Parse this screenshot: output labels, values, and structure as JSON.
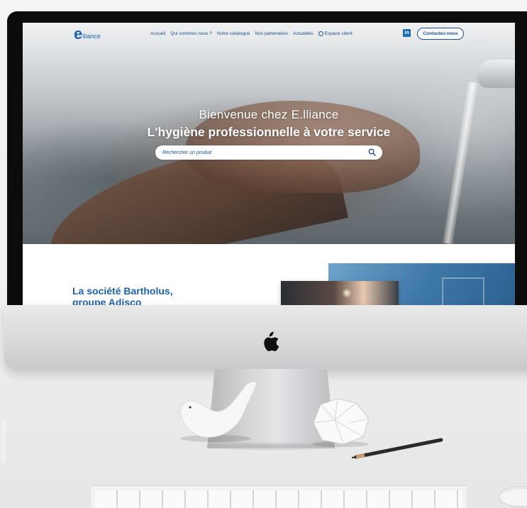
{
  "site": {
    "logo": {
      "mark": "e",
      "text": "lliance"
    },
    "nav": {
      "links": [
        "Accueil",
        "Qui sommes nous ?",
        "Notre catalogue",
        "Nos partenaires",
        "Actualités"
      ],
      "account_label": "Espace client",
      "linkedin_icon": "linkedin-icon",
      "contact_label": "Contactez-nous"
    },
    "hero": {
      "title": "Bienvenue chez E.lliance",
      "subtitle": "L'hygiène professionnelle à votre service",
      "search_placeholder": "Rechercher un produit"
    },
    "section": {
      "company_title_line1": "La société Bartholus,",
      "company_title_line2": "groupe Adisco"
    }
  },
  "colors": {
    "brand_blue": "#1d62ad",
    "nav_blue": "#1d4f8c",
    "linkedin_blue": "#1b6ab5"
  }
}
